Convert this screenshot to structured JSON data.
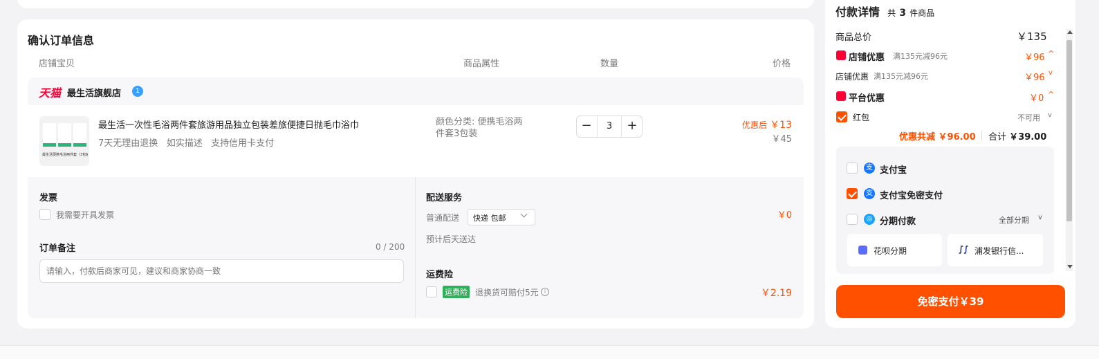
{
  "order": {
    "section_title": "确认订单信息",
    "columns": [
      "店铺宝贝",
      "商品属性",
      "数量",
      "价格"
    ],
    "store": {
      "brand_logo": "天猫",
      "name": "最生活旗舰店"
    },
    "item": {
      "thumb_caption": "最生活便携毛浴两件套（3包装）",
      "title": "最生活一次性毛浴两件套旅游用品独立包装差旅便捷日抛毛巾浴巾",
      "services": [
        "7天无理由退换",
        "如实描述",
        "支持信用卡支付"
      ],
      "attr_line1": "颜色分类: 便携毛浴两",
      "attr_line2": "件套3包装",
      "quantity": "3",
      "after_discount_label": "优惠后",
      "after_discount_price": "￥13",
      "original_price": "￥45"
    },
    "invoice": {
      "title": "发票",
      "option_label": "我需要开具发票"
    },
    "remarks": {
      "title": "订单备注",
      "counter": "0 / 200",
      "placeholder": "请输入，付款后商家可见，建议和商家协商一致"
    },
    "delivery": {
      "title": "配送服务",
      "method_label": "普通配送",
      "select_value": "快递 包邮",
      "eta": "预计后天送达",
      "fee": "￥0"
    },
    "insurance": {
      "title": "运费险",
      "badge": "运费险",
      "desc": "退换货可赔付5元",
      "price": "￥2.19"
    }
  },
  "payment": {
    "title": "付款详情",
    "count_text_pre": "共",
    "count": "3",
    "count_text_post": "件商品",
    "total_label": "商品总价",
    "total_value": "￥135",
    "store_discount_label": "店铺优惠",
    "store_discount_note": "满135元减96元",
    "store_discount_value": "￥96",
    "store_discount_sub_label": "店铺优惠",
    "store_discount_sub_note": "满135元减96元",
    "store_discount_sub_value": "￥96",
    "platform_discount_label": "平台优惠",
    "platform_discount_value": "￥0",
    "red_packet_label": "红包",
    "red_packet_status": "不可用",
    "summary_discount": "优惠共减 ￥96.00",
    "summary_total_label": "合计",
    "summary_total_value": "￥39.00",
    "methods": {
      "alipay": "支付宝",
      "alipay_nopwd": "支付宝免密支付",
      "installment": "分期付款",
      "installment_option": "全部分期",
      "huabei": "花呗分期",
      "spdb": "浦发银行信..."
    },
    "pay_button": "免密支付￥39"
  },
  "colors": {
    "accent": "#ff5000",
    "tmall_red": "#ff0036",
    "alipay_blue": "#1677ff",
    "green_badge": "#31b05b"
  },
  "icons": [
    "tmall-logo-icon",
    "store-badge-icon",
    "minus-icon",
    "plus-icon",
    "chevron-down-icon",
    "info-icon",
    "coupon-icon",
    "platform-coupon-icon",
    "chevron-up-icon",
    "alipay-icon",
    "installment-icon",
    "huabei-icon",
    "spdb-icon",
    "scroll-up-icon",
    "scroll-down-icon"
  ]
}
